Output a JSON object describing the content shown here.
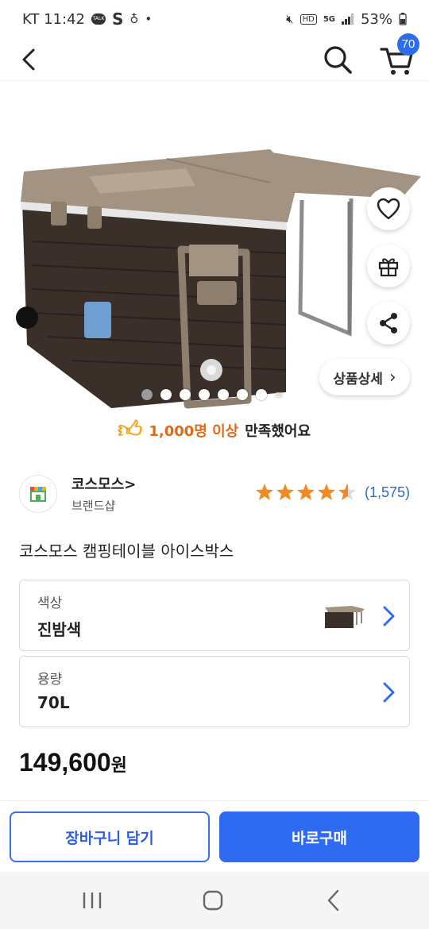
{
  "status_bar": {
    "carrier_time": "KT 11:42",
    "talk_badge": "TALK",
    "s_letter": "S",
    "dot": "•",
    "hd_label": "HD",
    "network": "5G",
    "battery": "53%"
  },
  "header": {
    "cart_count": "70"
  },
  "carousel": {
    "total_dots": 7,
    "active_index": 0,
    "more_label": "≡"
  },
  "detail_button": {
    "label": "상품상세",
    "arrow": "›"
  },
  "satisfaction": {
    "highlight": "1,000명 이상",
    "rest": "만족했어요"
  },
  "brand": {
    "name": "코스모스",
    "chevron": ">",
    "subtitle": "브랜드샵",
    "rating_stars": 4.5,
    "review_count": "(1,575)"
  },
  "product": {
    "title": "코스모스 캠핑테이블 아이스박스",
    "price": "149,600",
    "price_unit": "원"
  },
  "options": [
    {
      "label": "색상",
      "value": "진밤색"
    },
    {
      "label": "용량",
      "value": "70L"
    }
  ],
  "actions": {
    "add_to_cart": "장바구니 담기",
    "buy_now": "바로구매"
  },
  "colors": {
    "accent": "#2f6bf0",
    "highlight": "#e06a18",
    "star": "#f08a24",
    "cooler_body": "#3b2f2a",
    "cooler_lid": "#a39382"
  }
}
